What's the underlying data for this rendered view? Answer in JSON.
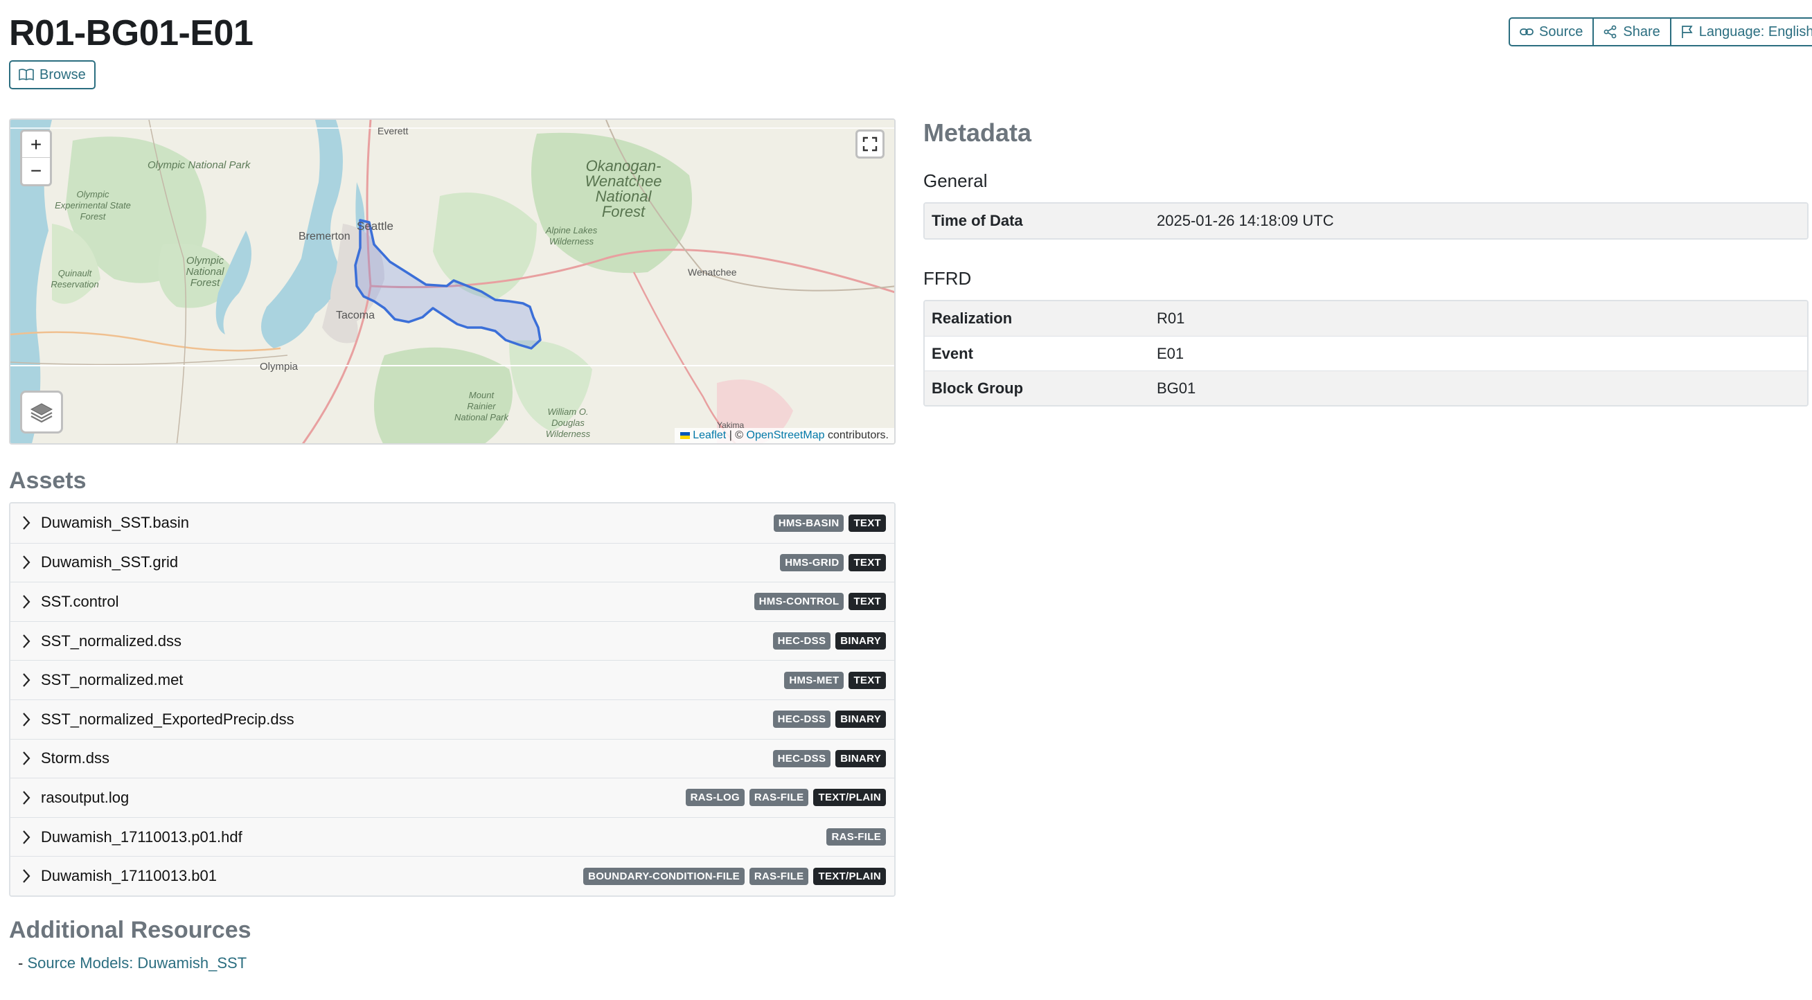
{
  "page": {
    "title": "R01-BG01-E01"
  },
  "header": {
    "browse_label": "Browse",
    "source_label": "Source",
    "share_label": "Share",
    "language_label": "Language: English"
  },
  "map": {
    "zoom_in": "+",
    "zoom_out": "−",
    "attribution": {
      "leaflet": "Leaflet",
      "sep": "| ©",
      "osm": "OpenStreetMap",
      "suffix": "contributors."
    },
    "labels": {
      "everett": "Everett",
      "olympic_np": "Olympic National Park",
      "olympic_exp": "Olympic Experimental State Forest",
      "olympic_nf": "Olympic National Forest",
      "quinault": "Quinault Reservation",
      "bremerton": "Bremerton",
      "seattle": "Seattle",
      "tacoma": "Tacoma",
      "olympia": "Olympia",
      "okanogan": "Okanogan-Wenatchee National Forest",
      "alpine": "Alpine Lakes Wilderness",
      "wenatchee": "Wenatchee",
      "rainier": "Mount Rainier National Park",
      "douglas": "William O. Douglas Wilderness",
      "yakima": "Yakima"
    }
  },
  "metadata": {
    "title": "Metadata",
    "general": {
      "title": "General",
      "rows": [
        {
          "key": "Time of Data",
          "value": "2025-01-26 14:18:09 UTC"
        }
      ]
    },
    "ffrd": {
      "title": "FFRD",
      "rows": [
        {
          "key": "Realization",
          "value": "R01"
        },
        {
          "key": "Event",
          "value": "E01"
        },
        {
          "key": "Block Group",
          "value": "BG01"
        }
      ]
    }
  },
  "assets": {
    "title": "Assets",
    "items": [
      {
        "name": "Duwamish_SST.basin",
        "badges": [
          "HMS-BASIN",
          "TEXT"
        ]
      },
      {
        "name": "Duwamish_SST.grid",
        "badges": [
          "HMS-GRID",
          "TEXT"
        ]
      },
      {
        "name": "SST.control",
        "badges": [
          "HMS-CONTROL",
          "TEXT"
        ]
      },
      {
        "name": "SST_normalized.dss",
        "badges": [
          "HEC-DSS",
          "BINARY"
        ]
      },
      {
        "name": "SST_normalized.met",
        "badges": [
          "HMS-MET",
          "TEXT"
        ]
      },
      {
        "name": "SST_normalized_ExportedPrecip.dss",
        "badges": [
          "HEC-DSS",
          "BINARY"
        ]
      },
      {
        "name": "Storm.dss",
        "badges": [
          "HEC-DSS",
          "BINARY"
        ]
      },
      {
        "name": "rasoutput.log",
        "badges": [
          "RAS-LOG",
          "RAS-FILE",
          "TEXT/PLAIN"
        ]
      },
      {
        "name": "Duwamish_17110013.p01.hdf",
        "badges": [
          "RAS-FILE"
        ]
      },
      {
        "name": "Duwamish_17110013.b01",
        "badges": [
          "BOUNDARY-CONDITION-FILE",
          "RAS-FILE",
          "TEXT/PLAIN"
        ]
      }
    ]
  },
  "additional": {
    "title": "Additional Resources",
    "bullet": "-",
    "link": "Source Models: Duwamish_SST"
  },
  "colors": {
    "accent": "#2b6e80",
    "badge_role": "#6c757d",
    "badge_type": "#212529",
    "watershed": "#3b6fd8"
  }
}
